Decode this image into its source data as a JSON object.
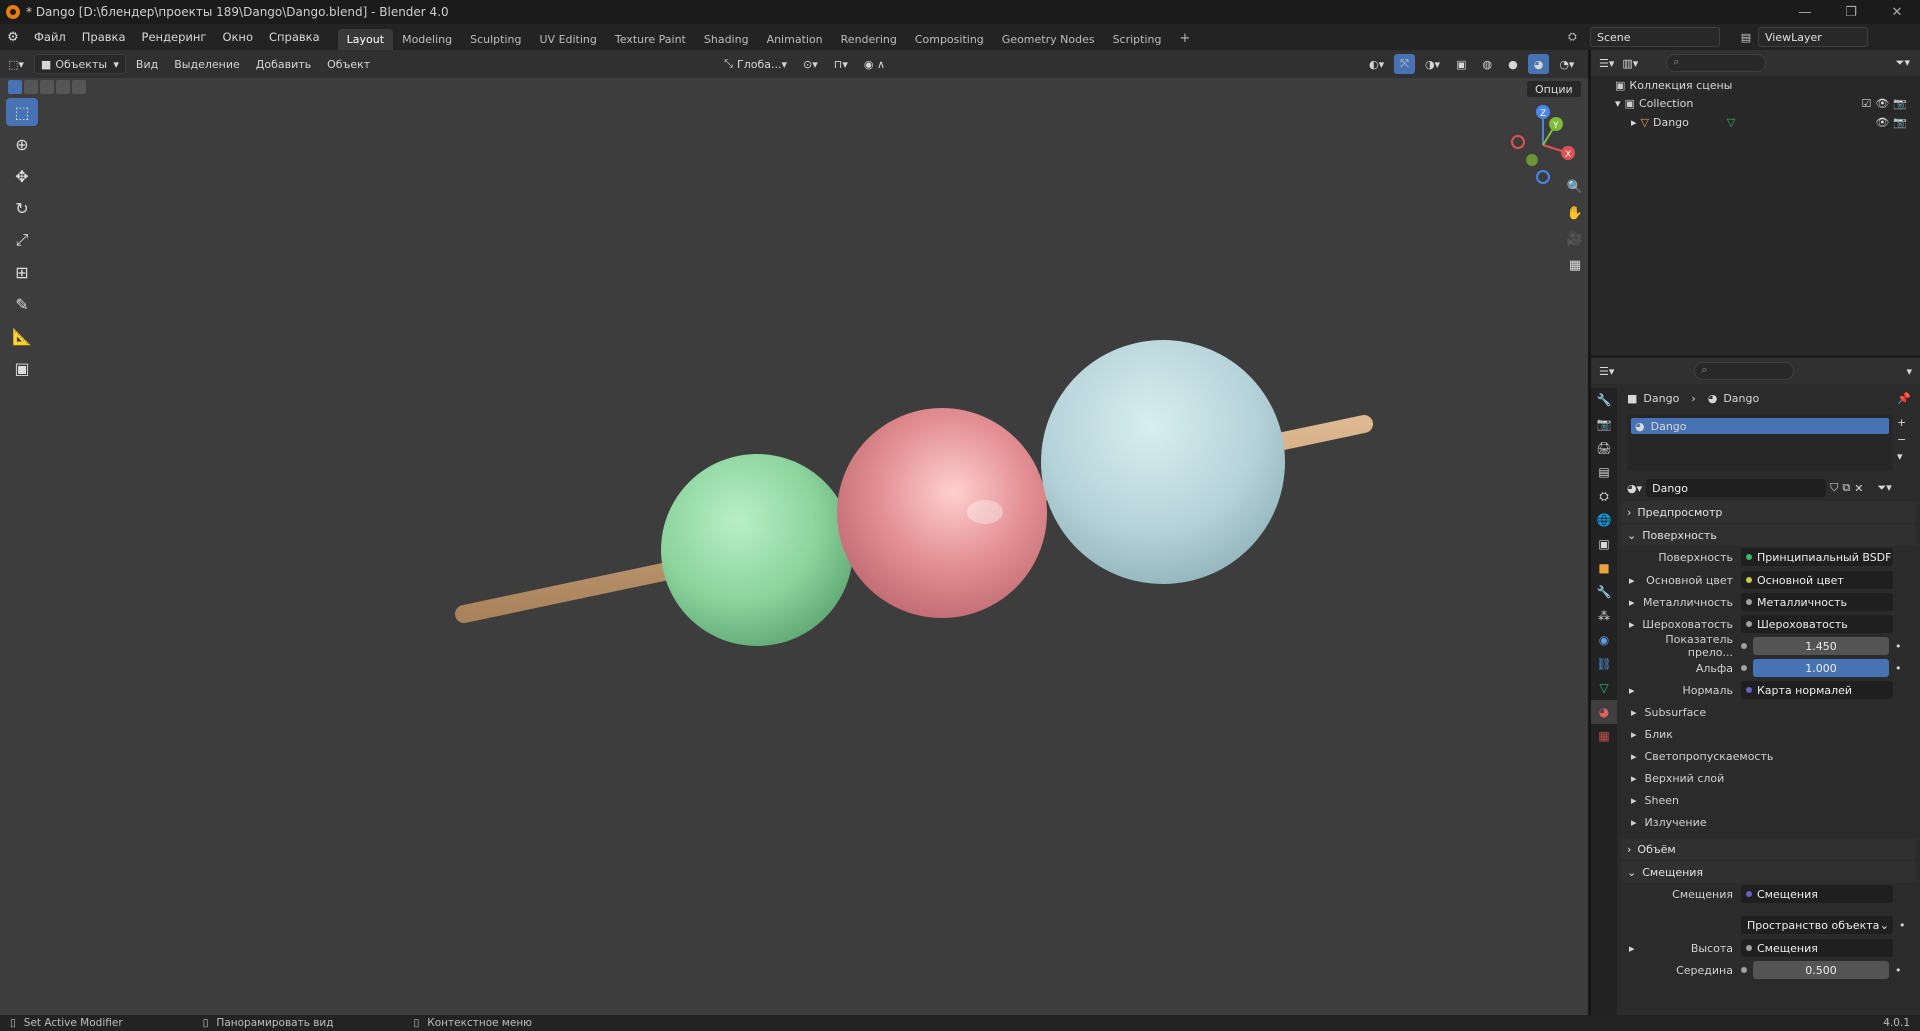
{
  "window": {
    "title": "* Dango [D:\\блендер\\проекты 189\\Dango\\Dango.blend] - Blender 4.0",
    "buttons": [
      "—",
      "❐",
      "✕"
    ]
  },
  "menu": [
    "Файл",
    "Правка",
    "Рендеринг",
    "Окно",
    "Справка"
  ],
  "workspaces": [
    "Layout",
    "Modeling",
    "Sculpting",
    "UV Editing",
    "Texture Paint",
    "Shading",
    "Animation",
    "Rendering",
    "Compositing",
    "Geometry Nodes",
    "Scripting"
  ],
  "workspace_active": "Layout",
  "scene": {
    "name": "Scene",
    "view_layer": "ViewLayer"
  },
  "viewport_header": {
    "mode": "Объекты",
    "menus": [
      "Вид",
      "Выделение",
      "Добавить",
      "Объект"
    ],
    "orientation": "Глоба...",
    "options": "Опции"
  },
  "gizmo": {
    "x": "X",
    "y": "Y",
    "z": "Z"
  },
  "outliner": {
    "root": "Коллекция сцены",
    "collection": "Collection",
    "object": "Dango"
  },
  "properties": {
    "breadcrumb_object": "Dango",
    "breadcrumb_material": "Dango",
    "slot": "Dango",
    "material_name": "Dango",
    "panels": {
      "preview": "Предпросмотр",
      "surface": "Поверхность",
      "volume": "Объём",
      "displacement": "Смещения"
    },
    "surface_rows": [
      {
        "label": "Поверхность",
        "value": "Принципиальный BSDF",
        "dot": "#2fbf66"
      },
      {
        "label": "Основной цвет",
        "value": "Основной цвет",
        "dot": "#c8c84a"
      },
      {
        "label": "Металличность",
        "value": "Металличность",
        "dot": "#a0a0a0"
      },
      {
        "label": "Шероховатость",
        "value": "Шероховатость",
        "dot": "#a0a0a0"
      },
      {
        "label": "Показатель прело...",
        "value": "1.450",
        "dot": "#a0a0a0"
      },
      {
        "label": "Альфа",
        "value": "1.000",
        "dot": "#a0a0a0"
      },
      {
        "label": "Нормаль",
        "value": "Карта нормалей",
        "dot": "#6363c7"
      }
    ],
    "subsections": [
      "Subsurface",
      "Блик",
      "Светопропускаемость",
      "Верхний слой",
      "Sheen",
      "Излучение"
    ],
    "displacement_rows": [
      {
        "label": "Смещения",
        "value": "Смещения",
        "dot": "#6363c7"
      },
      {
        "label": "",
        "value": "Пространство объекта",
        "dot": ""
      },
      {
        "label": "Высота",
        "value": "Смещения",
        "dot": "#a0a0a0"
      },
      {
        "label": "Середина",
        "value": "0.500",
        "dot": "#a0a0a0"
      }
    ]
  },
  "status": {
    "left": "Set Active Modifier",
    "middle": "Панорамировать вид",
    "right": "Контекстное меню",
    "version": "4.0.1"
  },
  "colors": {
    "accent": "#4772b3",
    "viewport_bg": "#3d3d3d",
    "ball_green": "#8fd6a0",
    "ball_pink": "#e08a8f",
    "ball_blue": "#b9d6dc",
    "stick": "#c9a37a"
  }
}
